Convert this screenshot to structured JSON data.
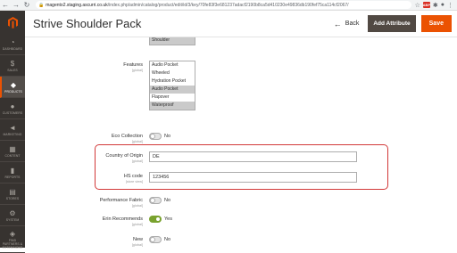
{
  "browser": {
    "url_host": "magento2.staging.ascurri.co.uk",
    "url_path": "/index.php/admin/catalog/product/edit/id/3/key/70fe83f3e681237adacf2190b8ca5d410230e49836db190fef75ca114cf2067/",
    "ext_badge": "ABP"
  },
  "sidebar": {
    "items": [
      {
        "label": "Dashboard",
        "icon": "dashboard-icon",
        "glyph": "◔"
      },
      {
        "label": "Sales",
        "icon": "dollar-icon",
        "glyph": "$"
      },
      {
        "label": "Products",
        "icon": "cube-icon",
        "glyph": "◆"
      },
      {
        "label": "Customers",
        "icon": "user-icon",
        "glyph": "●"
      },
      {
        "label": "Marketing",
        "icon": "megaphone-icon",
        "glyph": "◄"
      },
      {
        "label": "Content",
        "icon": "content-icon",
        "glyph": "▦"
      },
      {
        "label": "Reports",
        "icon": "reports-icon",
        "glyph": "▮"
      },
      {
        "label": "Stores",
        "icon": "store-icon",
        "glyph": "▤"
      },
      {
        "label": "System",
        "icon": "gear-icon",
        "glyph": "⚙"
      },
      {
        "label": "Find Partners & Extensions",
        "icon": "extensions-icon",
        "glyph": "◈"
      }
    ],
    "active_index": 2
  },
  "header": {
    "title": "Strive Shoulder Pack",
    "back_label": "Back",
    "add_attribute_label": "Add Attribute",
    "save_label": "Save"
  },
  "form": {
    "top_option": "Shoulder",
    "features": {
      "label": "Features",
      "scope": "[global]",
      "options": [
        {
          "text": "Audio Pocket",
          "selected": false
        },
        {
          "text": "Wheeled",
          "selected": false
        },
        {
          "text": "Hydration Pocket",
          "selected": false
        },
        {
          "text": "Audio Pocket",
          "selected": true
        },
        {
          "text": "Flapover",
          "selected": false
        },
        {
          "text": "Waterproof",
          "selected": true
        }
      ]
    },
    "eco_collection": {
      "label": "Eco Collection",
      "scope": "[global]",
      "value": "No",
      "on": false
    },
    "country_of_origin": {
      "label": "Country of Origin",
      "scope": "[global]",
      "value": "DE"
    },
    "hs_code": {
      "label": "HS code",
      "scope": "[store view]",
      "value": "123456"
    },
    "performance_fabric": {
      "label": "Performance Fabric",
      "scope": "[global]",
      "value": "No",
      "on": false
    },
    "erin_recommends": {
      "label": "Erin Recommends",
      "scope": "[global]",
      "value": "Yes",
      "on": true
    },
    "new": {
      "label": "New",
      "scope": "[global]",
      "value": "No",
      "on": false
    }
  },
  "colors": {
    "accent": "#eb5202",
    "highlight": "#d23838",
    "toggle_on": "#79a22e",
    "sidebar": "#373330"
  }
}
